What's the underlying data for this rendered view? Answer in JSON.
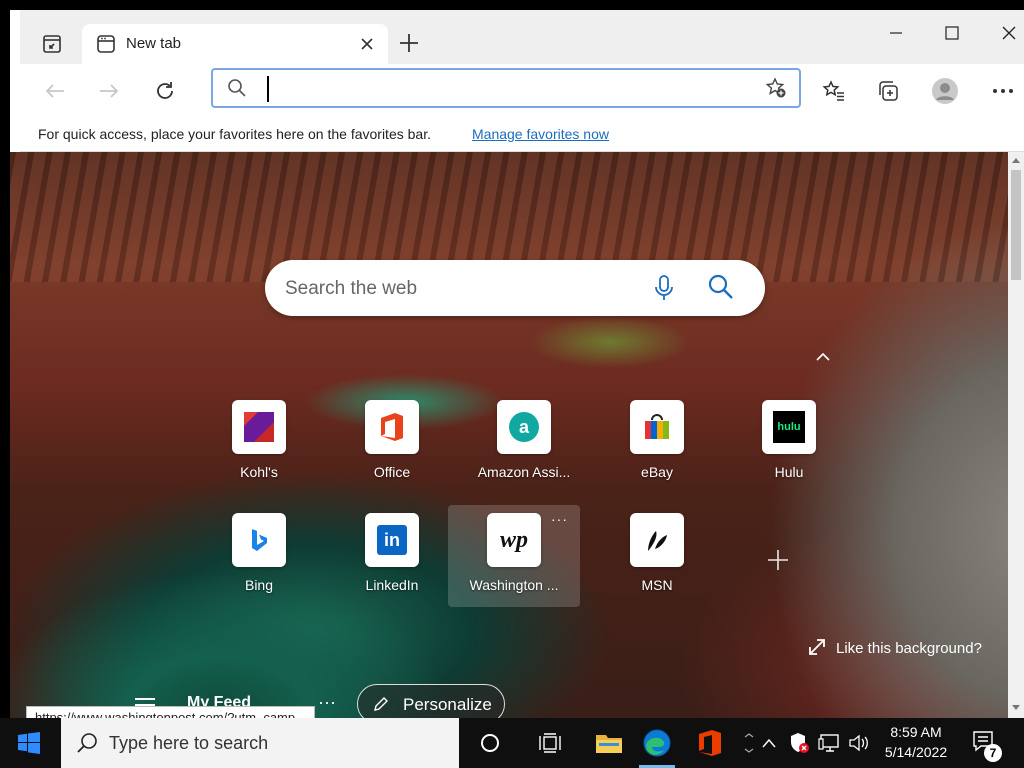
{
  "browser": {
    "tab": {
      "title": "New tab"
    },
    "address": {
      "value": "",
      "placeholder": ""
    },
    "favorites_bar": {
      "message": "For quick access, place your favorites here on the favorites bar.",
      "link": "Manage favorites now"
    }
  },
  "ntp": {
    "search_placeholder": "Search the web",
    "tiles": [
      {
        "label": "Kohl's",
        "icon": "kohls-icon"
      },
      {
        "label": "Office",
        "icon": "office-icon"
      },
      {
        "label": "Amazon Assi...",
        "icon": "amazon-assistant-icon"
      },
      {
        "label": "eBay",
        "icon": "ebay-icon"
      },
      {
        "label": "Hulu",
        "icon": "hulu-icon",
        "icon_text": "hulu"
      },
      {
        "label": "Bing",
        "icon": "bing-icon"
      },
      {
        "label": "LinkedIn",
        "icon": "linkedin-icon",
        "icon_text": "in"
      },
      {
        "label": "Washington ...",
        "icon": "washington-post-icon",
        "icon_text": "wp",
        "more": "···"
      },
      {
        "label": "MSN",
        "icon": "msn-icon"
      }
    ],
    "like_background": "Like this background?",
    "my_feed": "My Feed",
    "feed_more": "···",
    "personalize": "Personalize"
  },
  "status_url": "https://www.washingtonpost.com/?utm_camp...",
  "taskbar": {
    "search_placeholder": "Type here to search",
    "time": "8:59 AM",
    "date": "5/14/2022",
    "notification_count": "7"
  },
  "colors": {
    "accent": "#0078d4",
    "address_border": "#7aa7e0",
    "link": "#1a6dbf",
    "taskbar": "#0f0f0f"
  }
}
